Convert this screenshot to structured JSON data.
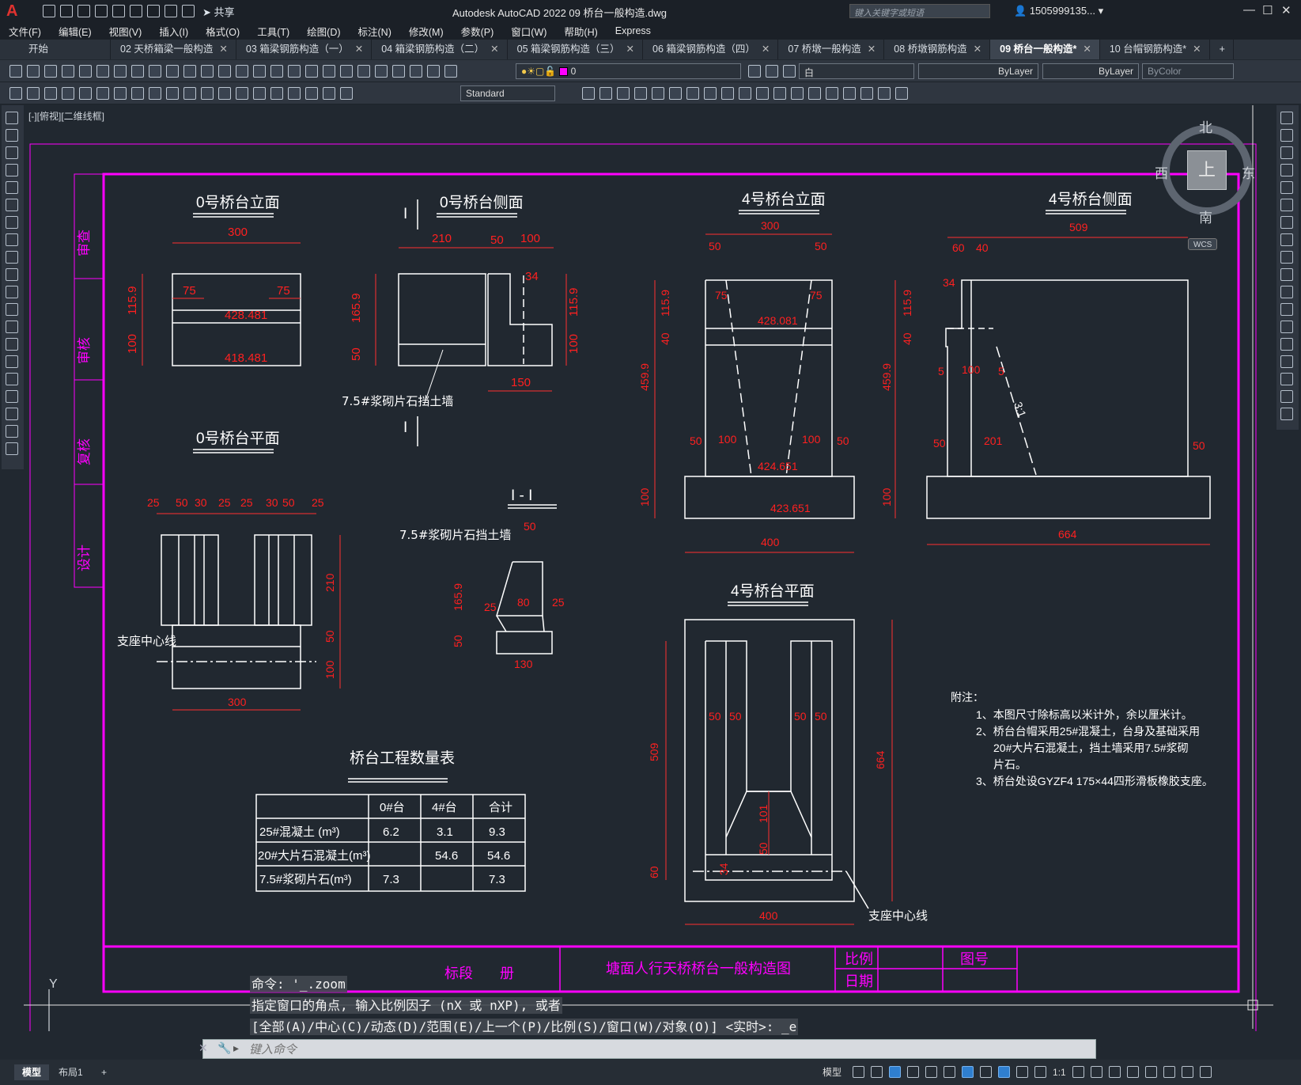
{
  "window": {
    "app_title": "Autodesk AutoCAD 2022    09 桥台一般构造.dwg",
    "share_label": "共享",
    "search_placeholder": "键入关键字或短语",
    "user_name": "1505999135...",
    "logo_letter": "A"
  },
  "menu": [
    "文件(F)",
    "编辑(E)",
    "视图(V)",
    "插入(I)",
    "格式(O)",
    "工具(T)",
    "绘图(D)",
    "标注(N)",
    "修改(M)",
    "参数(P)",
    "窗口(W)",
    "帮助(H)",
    "Express"
  ],
  "tabs": [
    {
      "label": "开始",
      "closable": false,
      "active": false
    },
    {
      "label": "02 天桥箱梁一般构造",
      "closable": true,
      "active": false
    },
    {
      "label": "03 箱梁钢筋构造（一）",
      "closable": true,
      "active": false
    },
    {
      "label": "04 箱梁钢筋构造（二）",
      "closable": true,
      "active": false
    },
    {
      "label": "05 箱梁钢筋构造（三）",
      "closable": true,
      "active": false
    },
    {
      "label": "06 箱梁钢筋构造（四）",
      "closable": true,
      "active": false
    },
    {
      "label": "07 桥墩一般构造",
      "closable": true,
      "active": false
    },
    {
      "label": "08 桥墩钢筋构造",
      "closable": true,
      "active": false
    },
    {
      "label": "09 桥台一般构造*",
      "closable": true,
      "active": true
    },
    {
      "label": "10 台帽钢筋构造*",
      "closable": true,
      "active": false
    }
  ],
  "toolbar": {
    "layer_value": "0",
    "color_value": "白",
    "linetype_value": "ByLayer",
    "lineweight_value": "ByLayer",
    "plotstyle_value": "ByColor",
    "textstyle_value": "Standard"
  },
  "viewport": {
    "label": "[-][俯视][二维线框]",
    "compass": {
      "north": "北",
      "south": "南",
      "east": "东",
      "west": "西",
      "top": "上",
      "wcs": "WCS"
    }
  },
  "drawing": {
    "colors": {
      "frame": "#ff00ff",
      "lines": "#ffffff",
      "dims": "#ff1a1a",
      "bg": "#212830"
    },
    "side_labels": [
      "审查",
      "审核",
      "复核",
      "设计"
    ],
    "views": {
      "v0_elev": "0号桥台立面",
      "v0_side": "0号桥台侧面",
      "v0_plan": "0号桥台平面",
      "v4_elev": "4号桥台立面",
      "v4_side": "4号桥台侧面",
      "v4_plan": "4号桥台平面",
      "section": "I - I",
      "section_mark": "I"
    },
    "labels": {
      "wall_note": "7.5#浆砌片石挡土墙",
      "bearing_line": "支座中心线",
      "slope": "3:1"
    },
    "dims": {
      "v0e_top": "300",
      "v0e_l": "75",
      "v0e_r": "75",
      "v0e_h1": "115.9",
      "v0e_h2": "100",
      "v0e_el1": "428.481",
      "v0e_el2": "418.481",
      "v0s_a": "210",
      "v0s_b": "50",
      "v0s_c": "100",
      "v0s_d": "34",
      "v0s_h1": "165.9",
      "v0s_h2": "50",
      "v0s_r1": "115.9",
      "v0s_r2": "100",
      "v0s_bot": "150",
      "v0p_t": [
        "25",
        "50",
        "30",
        "25",
        "25",
        "30",
        "50",
        "25"
      ],
      "v0p_r1": "210",
      "v0p_r2": "50",
      "v0p_r3": "100",
      "v0p_bot": "300",
      "sec_top": "50",
      "sec_h1": "165.9",
      "sec_h2": "50",
      "sec_a": "25",
      "sec_b": "80",
      "sec_c": "25",
      "sec_bot": "130",
      "v4e_top": "300",
      "v4e_l": "50",
      "v4e_r": "50",
      "v4e_il": "75",
      "v4e_ir": "75",
      "v4e_h1": "115.9",
      "v4e_h2": "40",
      "v4e_h3": "459.9",
      "v4e_h4": "100",
      "v4e_el1": "428.081",
      "v4e_el2": "424.651",
      "v4e_el3": "423.651",
      "v4e_b1": "50",
      "v4e_b2": "100",
      "v4e_b3": "100",
      "v4e_b4": "50",
      "v4e_bot": "400",
      "v4s_top": "509",
      "v4s_a": "60",
      "v4s_b": "40",
      "v4s_c": "34",
      "v4s_h1": "115.9",
      "v4s_h2": "40",
      "v4s_h3": "459.9",
      "v4s_h4": "100",
      "v4s_m1": "5",
      "v4s_m2": "100",
      "v4s_m3": "5",
      "v4s_b1": "50",
      "v4s_b2": "201",
      "v4s_b3": "50",
      "v4s_bot": "664",
      "v4p_w": [
        "50",
        "50",
        "50",
        "50"
      ],
      "v4p_h1": "509",
      "v4p_h2": "60",
      "v4p_h3": "664",
      "v4p_i1": "101",
      "v4p_i2": "50",
      "v4p_i3": "34",
      "v4p_bot": "400"
    },
    "notes": {
      "heading": "附注：",
      "lines": [
        "1、本图尺寸除标高以米计外，余以厘米计。",
        "2、桥台台帽采用25#混凝土，台身及基础采用",
        "20#大片石混凝土，挡土墙采用7.5#浆砌",
        "片石。",
        "3、桥台处设GYZF4 175×44四形滑板橡胶支座。"
      ]
    },
    "table": {
      "title": "桥台工程数量表",
      "headers": [
        "",
        "0#台",
        "4#台",
        "合计"
      ],
      "rows": [
        [
          "25#混凝土  (m³)",
          "6.2",
          "3.1",
          "9.3"
        ],
        [
          "20#大片石混凝土(m³)",
          "",
          "54.6",
          "54.6"
        ],
        [
          "7.5#浆砌片石(m³)",
          "7.3",
          "",
          "7.3"
        ]
      ]
    },
    "titleblock": {
      "section": "标段",
      "volume": "册",
      "title": "塘面人行天桥桥台一般构造图",
      "scale": "比例",
      "date": "日期",
      "figno": "图号"
    }
  },
  "command": {
    "history": [
      "命令: '_.zoom",
      "指定窗口的角点, 输入比例因子 (nX 或 nXP), 或者",
      "[全部(A)/中心(C)/动态(D)/范围(E)/上一个(P)/比例(S)/窗口(W)/对象(O)] <实时>: _e"
    ],
    "placeholder": "键入命令"
  },
  "statusbar": {
    "model_tab": "模型",
    "layout_tab": "布局1",
    "add_tab": "+",
    "model_label": "模型",
    "scale": "1:1"
  }
}
